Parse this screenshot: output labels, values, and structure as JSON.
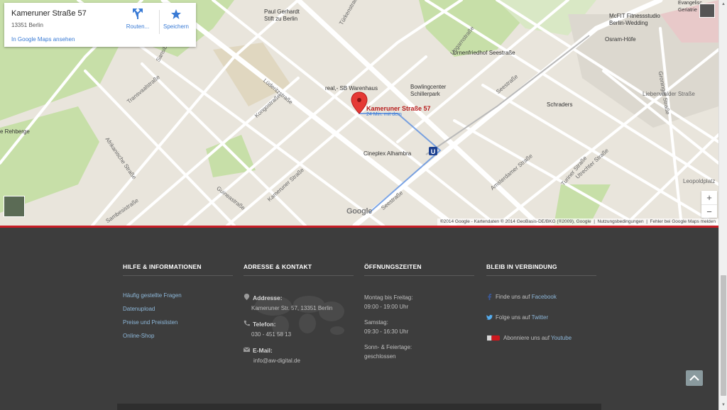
{
  "map": {
    "place_title": "Kameruner Straße 57",
    "place_address": "13351 Berlin",
    "view_in_maps_link": "In Google Maps ansehen",
    "action_route": "Routen...",
    "action_save": "Speichern",
    "marker_label": "Kameruner Straße 57",
    "marker_sub": "24 Min. mit dem",
    "zoom_in": "+",
    "zoom_out": "−",
    "logo": "Google",
    "copyright": "®2014 Google - Kartendaten ® 2014 GeoBasis-DE/BKG (®2009), Google",
    "terms": "Nutzungsbedingungen",
    "report": "Fehler bei Google Maps melden",
    "streets": [
      "Sansibarstraße",
      "Transvaalstraße",
      "Afrikanische Straße",
      "Lüderitzstraße",
      "Kongostraße",
      "Kameruner Straße",
      "Guineastraße",
      "Sambesistraße",
      "Seestraße",
      "Seestraße",
      "Türkenstraße",
      "Ungarnstraße",
      "Amsterdamer Straße",
      "Utrechter Straße",
      "Turiner Straße",
      "Groninger Straße",
      "Liebenwalder Straße",
      "Leopoldplatz"
    ],
    "pois": [
      {
        "name": "Paul Gerhardt\nStift zu Berlin"
      },
      {
        "name": "real,- SB Warenhaus"
      },
      {
        "name": "Bowlingcenter\nSchillerpark"
      },
      {
        "name": "Urnenfriedhof Seestraße"
      },
      {
        "name": "Cineplex Alhambra"
      },
      {
        "name": "Schraders"
      },
      {
        "name": "McFIT Fitnessstudio\nBerlin-Wedding"
      },
      {
        "name": "Osram-Höfe"
      },
      {
        "name": "Evangelisc\nGeriatrie"
      },
      {
        "name": "e Rehberge"
      }
    ]
  },
  "footer": {
    "col1": {
      "heading": "HILFE & INFORMATIONEN",
      "links": [
        "Häufig gestellte Fragen",
        "Datenupload",
        "Preise und Preislisten",
        "Online-Shop"
      ]
    },
    "col2": {
      "heading": "ADRESSE & KONTAKT",
      "address_label": "Addresse:",
      "address": "Kameruner Str. 57, 13351 Berlin",
      "phone_label": "Telefon:",
      "phone": "030 - 451 58 13",
      "email_label": "E-Mail:",
      "email": "info@aw-digital.de"
    },
    "col3": {
      "heading": "ÖFFNUNGSZEITEN",
      "weekday_label": "Montag bis Freitag:",
      "weekday_hours": "09:00 - 19:00 Uhr",
      "sat_label": "Samstag:",
      "sat_hours": "09:30 - 16:30 Uhr",
      "sun_label": "Sonn- & Feiertage:",
      "sun_hours": "geschlossen"
    },
    "col4": {
      "heading": "BLEIB IN VERBINDUNG",
      "facebook_prefix": "Finde uns auf ",
      "facebook": "Facebook",
      "twitter_prefix": "Folge uns auf ",
      "twitter": "Twitter",
      "youtube_prefix": "Abonniere uns auf ",
      "youtube": "Youtube"
    }
  },
  "colors": {
    "accent_red": "#c81d25",
    "footer_bg": "#3d3d3d",
    "link_blue": "#8db7d9"
  }
}
